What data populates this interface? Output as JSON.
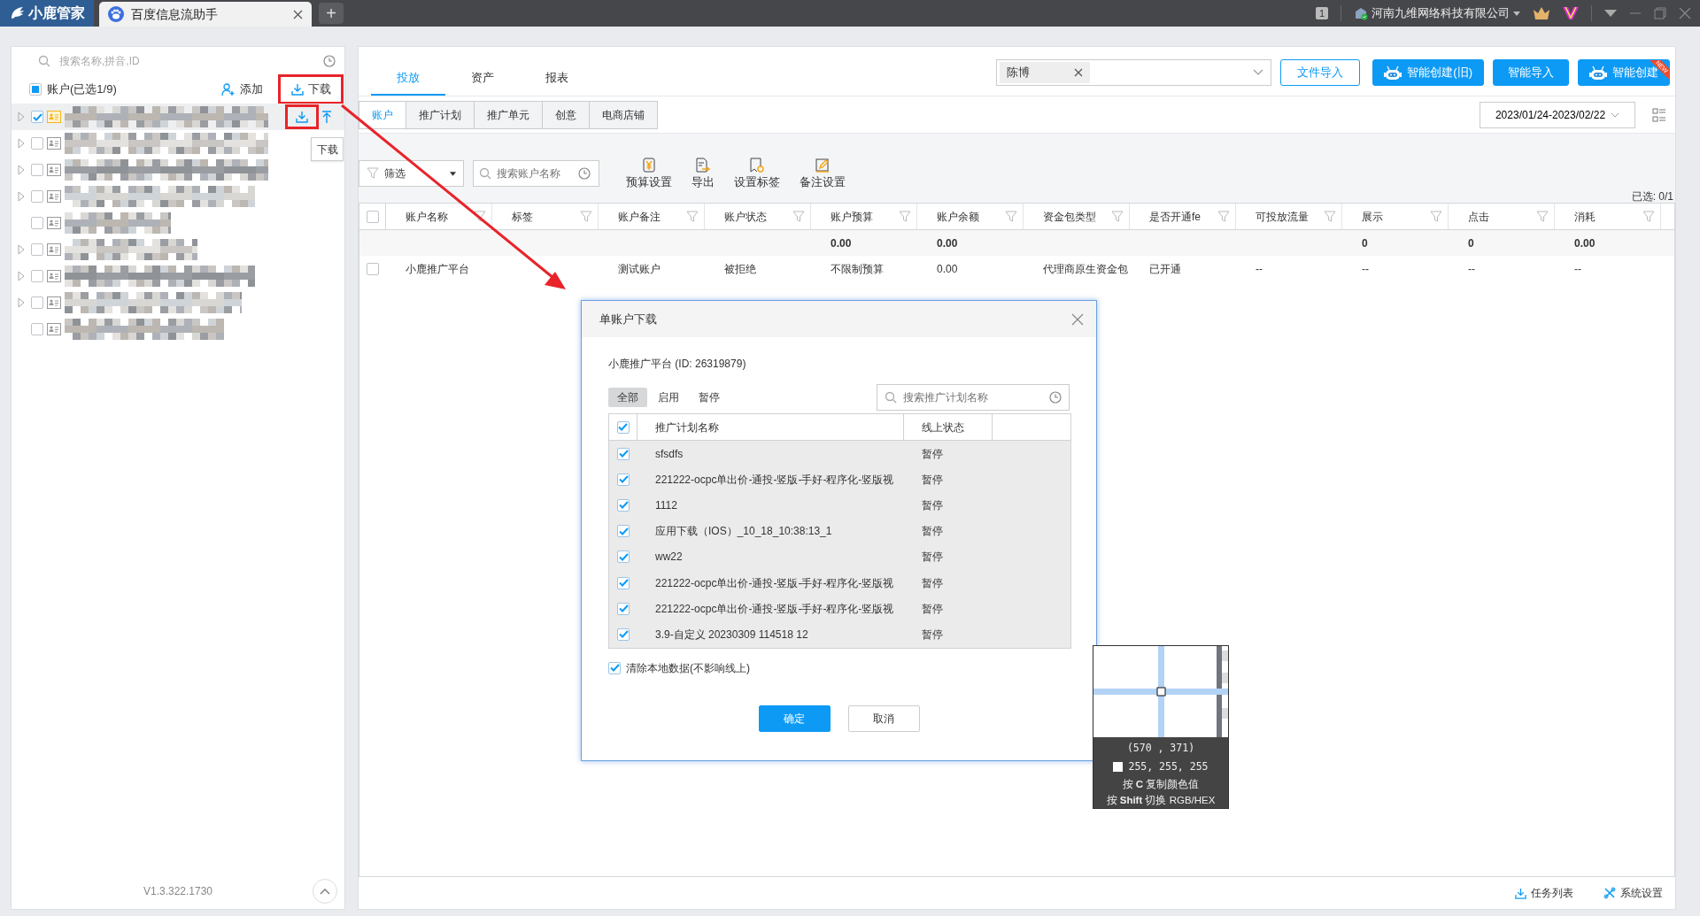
{
  "titlebar": {
    "app_name": "小鹿管家",
    "tabs": [
      {
        "label": "百度信息流助手",
        "selected": true
      }
    ],
    "new_tab": "+",
    "user_badge": "1",
    "company": "河南九维网络科技有限公司"
  },
  "sidebar": {
    "search": {
      "placeholder": "搜索名称,拼音,ID"
    },
    "header": {
      "label": "账户(已选1/9)",
      "indeterminate": true,
      "add": "添加",
      "download": "下载",
      "download_highlighted": true
    },
    "accounts": [
      {
        "expandable": true,
        "checked": true,
        "selected": true,
        "actions": {
          "download_highlighted": true
        }
      },
      {
        "expandable": true,
        "checked": false,
        "selected": false
      },
      {
        "expandable": true,
        "checked": false,
        "selected": false
      },
      {
        "expandable": true,
        "checked": false,
        "selected": false
      },
      {
        "expandable": false,
        "checked": false,
        "selected": false
      },
      {
        "expandable": true,
        "checked": false,
        "selected": false
      },
      {
        "expandable": true,
        "checked": false,
        "selected": false
      },
      {
        "expandable": true,
        "checked": false,
        "selected": false
      },
      {
        "expandable": false,
        "checked": false,
        "selected": false
      }
    ],
    "tooltip": "下载",
    "version": "V1.3.322.1730"
  },
  "annotation_arrow": true,
  "main": {
    "tabs": [
      {
        "label": "投放",
        "selected": true
      },
      {
        "label": "资产",
        "selected": false
      },
      {
        "label": "报表",
        "selected": false
      }
    ],
    "owner_select": {
      "chips": [
        "陈博"
      ]
    },
    "buttons": [
      {
        "label": "文件导入",
        "kind": "outline"
      },
      {
        "label": "智能创建(旧)",
        "kind": "robot"
      },
      {
        "label": "智能导入",
        "kind": "primary"
      },
      {
        "label": "智能创建",
        "kind": "robot",
        "ribbon": "NEW"
      }
    ],
    "subtabs": [
      {
        "label": "账户",
        "selected": true
      },
      {
        "label": "推广计划",
        "selected": false
      },
      {
        "label": "推广单元",
        "selected": false
      },
      {
        "label": "创意",
        "selected": false
      },
      {
        "label": "电商店铺",
        "selected": false
      }
    ],
    "date_range": "2023/01/24-2023/02/22",
    "toolbar": {
      "filter": "筛选",
      "search_placeholder": "搜索账户名称",
      "actions": [
        {
          "label": "预算设置",
          "kind": "budget"
        },
        {
          "label": "导出",
          "kind": "export"
        },
        {
          "label": "设置标签",
          "kind": "tag"
        },
        {
          "label": "备注设置",
          "kind": "note"
        }
      ]
    },
    "selection": "已选: 0/1",
    "table": {
      "all_checked": false,
      "columns": [
        {
          "label": "账户名称"
        },
        {
          "label": "标签"
        },
        {
          "label": "账户备注"
        },
        {
          "label": "账户状态"
        },
        {
          "label": "账户预算",
          "total": "0.00"
        },
        {
          "label": "账户余额",
          "total": "0.00"
        },
        {
          "label": "资金包类型"
        },
        {
          "label": "是否开通fe"
        },
        {
          "label": "可投放流量"
        },
        {
          "label": "展示",
          "total": "0"
        },
        {
          "label": "点击",
          "total": "0"
        },
        {
          "label": "消耗",
          "total": "0.00"
        }
      ],
      "rows": [
        {
          "checked": false,
          "cells": [
            {
              "text": "小鹿推广平台"
            },
            {},
            {
              "text": "测试账户"
            },
            {
              "text": "被拒绝"
            },
            {
              "text": "不限制预算"
            },
            {
              "text": "0.00"
            },
            {
              "text": "代理商原生资金包"
            },
            {
              "text": "已开通"
            },
            {
              "text": "--"
            },
            {
              "text": "--"
            },
            {
              "text": "--"
            },
            {
              "text": "--"
            }
          ]
        }
      ]
    },
    "footer": [
      {
        "label": "任务列表",
        "kind": "download"
      },
      {
        "label": "系统设置",
        "kind": "settings"
      }
    ]
  },
  "dialog": {
    "title": "单账户下载",
    "account": "小鹿推广平台 (ID: 26319879)",
    "filters": [
      {
        "label": "全部",
        "selected": true
      },
      {
        "label": "启用",
        "selected": false
      },
      {
        "label": "暂停",
        "selected": false
      }
    ],
    "search_placeholder": "搜索推广计划名称",
    "all_checked": true,
    "columns": [
      "推广计划名称",
      "线上状态"
    ],
    "rows": [
      {
        "name": "sfsdfs",
        "status": "暂停",
        "checked": true
      },
      {
        "name": "221222-ocpc单出价-通投-竖版-手好-程序化-竖版视",
        "status": "暂停",
        "checked": true
      },
      {
        "name": "1112",
        "status": "暂停",
        "checked": true
      },
      {
        "name": "应用下载（IOS）_10_18_10:38:13_1",
        "status": "暂停",
        "checked": true
      },
      {
        "name": "ww22",
        "status": "暂停",
        "checked": true
      },
      {
        "name": "221222-ocpc单出价-通投-竖版-手好-程序化-竖版视",
        "status": "暂停",
        "checked": true
      },
      {
        "name": "221222-ocpc单出价-通投-竖版-手好-程序化-竖版视",
        "status": "暂停",
        "checked": true
      },
      {
        "name": "3.9-自定义 20230309 114518 12",
        "status": "暂停",
        "checked": true
      }
    ],
    "clear_local": {
      "label": "清除本地数据(不影响线上)",
      "checked": true
    },
    "ok": "确定",
    "cancel": "取消"
  },
  "color_picker": {
    "coords": "(570 , 371)",
    "rgb": "255, 255, 255",
    "hints": [
      "按 **C** 复制颜色值",
      "按 **Shift** 切换 RGB/HEX"
    ]
  }
}
